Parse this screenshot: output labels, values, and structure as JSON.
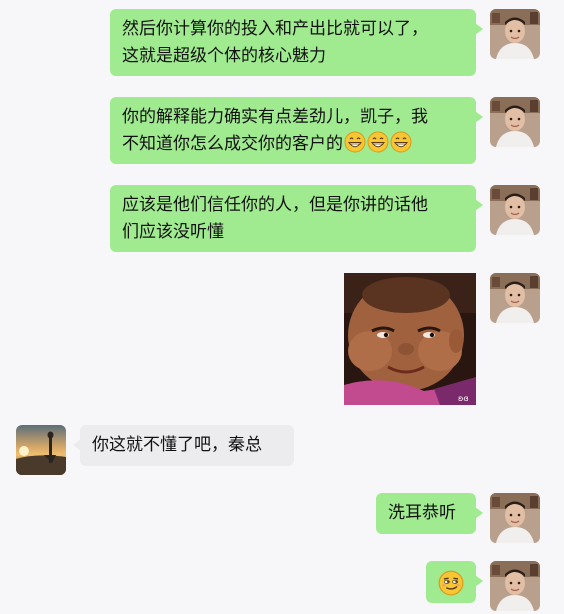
{
  "messages": [
    {
      "side": "right",
      "lines": [
        "然后你计算你的投入和产出比就可以了，",
        "这就是超级个体的核心魅力"
      ]
    },
    {
      "side": "right",
      "lines": [
        "你的解释能力确实有点差劲儿，凯子，我",
        "不知道你怎么成交你的客户的"
      ],
      "emojis": [
        "grin-emoji",
        "grin-emoji",
        "grin-emoji"
      ]
    },
    {
      "side": "right",
      "lines": [
        "应该是他们信任你的人，但是你讲的话他",
        "们应该没听懂"
      ]
    },
    {
      "side": "right",
      "type": "image",
      "image": "smiling-baby-sticker"
    },
    {
      "side": "left",
      "lines": [
        "你这就不懂了吧，秦总"
      ]
    },
    {
      "side": "right",
      "lines": [
        "洗耳恭听"
      ]
    },
    {
      "side": "right",
      "type": "emoji",
      "emoji": "smirk-emoji"
    }
  ],
  "colors": {
    "background": "#f7f7f9",
    "outgoing_bubble": "#a0ea8f",
    "incoming_bubble": "#ececee"
  }
}
